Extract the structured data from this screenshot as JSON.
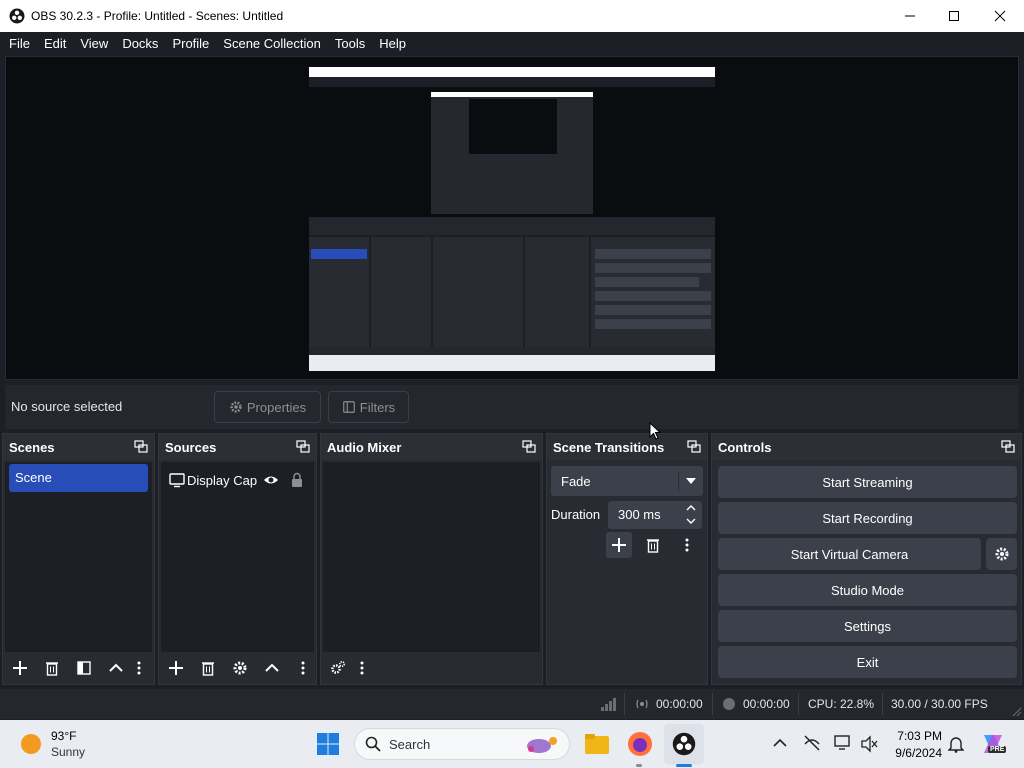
{
  "window": {
    "title": "OBS 30.2.3 - Profile: Untitled - Scenes: Untitled"
  },
  "menu": [
    "File",
    "Edit",
    "View",
    "Docks",
    "Profile",
    "Scene Collection",
    "Tools",
    "Help"
  ],
  "source_toolbar": {
    "no_source": "No source selected",
    "properties": "Properties",
    "filters": "Filters"
  },
  "docks": {
    "scenes": {
      "title": "Scenes",
      "items": [
        "Scene"
      ]
    },
    "sources": {
      "title": "Sources",
      "items": [
        "Display Cap"
      ]
    },
    "audio_mixer": {
      "title": "Audio Mixer"
    },
    "scene_transitions": {
      "title": "Scene Transitions",
      "transition": "Fade",
      "duration_label": "Duration",
      "duration_value": "300 ms"
    },
    "controls": {
      "title": "Controls",
      "start_streaming": "Start Streaming",
      "start_recording": "Start Recording",
      "start_virtual_camera": "Start Virtual Camera",
      "studio_mode": "Studio Mode",
      "settings": "Settings",
      "exit": "Exit"
    }
  },
  "status": {
    "stream_time": "00:00:00",
    "record_time": "00:00:00",
    "cpu": "CPU: 22.8%",
    "fps": "30.00 / 30.00 FPS"
  },
  "taskbar": {
    "weather_temp": "93°F",
    "weather_desc": "Sunny",
    "search": "Search",
    "time": "7:03 PM",
    "date": "9/6/2024",
    "copilot_badge": "PRE"
  },
  "colors": {
    "accent": "#284cb8",
    "bg": "#1d1f26",
    "dock": "#292b33",
    "button": "#3c404b"
  }
}
